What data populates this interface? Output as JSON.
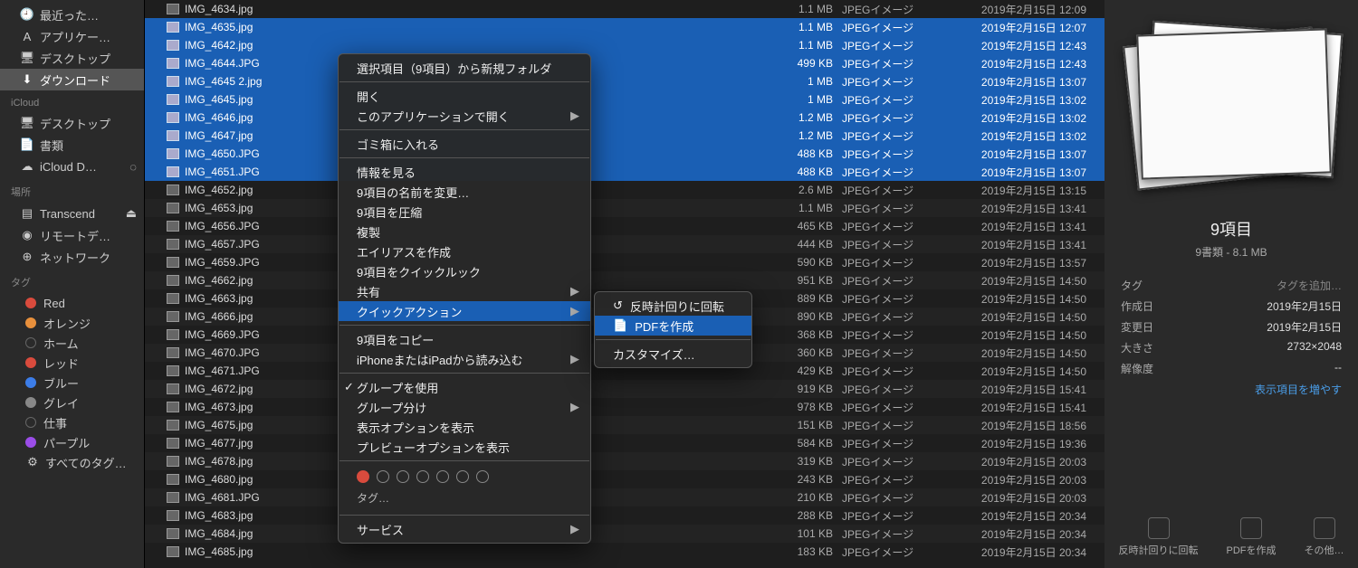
{
  "sidebar": {
    "favorites": [
      {
        "icon": "🕘",
        "label": "最近った…"
      },
      {
        "icon": "A",
        "label": "アプリケー…"
      },
      {
        "icon": "🖥",
        "label": "デスクトップ"
      },
      {
        "icon": "⬇",
        "label": "ダウンロード",
        "active": true
      }
    ],
    "icloud_header": "iCloud",
    "icloud": [
      {
        "icon": "🖥",
        "label": "デスクトップ"
      },
      {
        "icon": "📄",
        "label": "書類"
      },
      {
        "icon": "☁︎",
        "label": "iCloud D…",
        "spinner": true
      }
    ],
    "locations_header": "場所",
    "locations": [
      {
        "icon": "▤",
        "label": "Transcend",
        "eject": true
      },
      {
        "icon": "◉",
        "label": "リモートデ…"
      },
      {
        "icon": "⊕",
        "label": "ネットワーク"
      }
    ],
    "tags_header": "タグ",
    "tags": [
      {
        "color": "#d94b3d",
        "label": "Red"
      },
      {
        "color": "#e8903c",
        "label": "オレンジ"
      },
      {
        "color": "transparent",
        "label": "ホーム"
      },
      {
        "color": "#d94b3d",
        "label": "レッド"
      },
      {
        "color": "#3c7de8",
        "label": "ブルー"
      },
      {
        "color": "#888",
        "label": "グレイ"
      },
      {
        "color": "transparent",
        "label": "仕事"
      },
      {
        "color": "#9b4de8",
        "label": "パープル"
      },
      {
        "color": "gear",
        "label": "すべてのタグ…"
      }
    ]
  },
  "files": [
    {
      "n": "IMG_4634.jpg",
      "s": "1.1 MB",
      "k": "JPEGイメージ",
      "d": "2019年2月15日 12:09",
      "sel": false
    },
    {
      "n": "IMG_4635.jpg",
      "s": "1.1 MB",
      "k": "JPEGイメージ",
      "d": "2019年2月15日 12:07",
      "sel": true
    },
    {
      "n": "IMG_4642.jpg",
      "s": "1.1 MB",
      "k": "JPEGイメージ",
      "d": "2019年2月15日 12:43",
      "sel": true
    },
    {
      "n": "IMG_4644.JPG",
      "s": "499 KB",
      "k": "JPEGイメージ",
      "d": "2019年2月15日 12:43",
      "sel": true
    },
    {
      "n": "IMG_4645 2.jpg",
      "s": "1 MB",
      "k": "JPEGイメージ",
      "d": "2019年2月15日 13:07",
      "sel": true
    },
    {
      "n": "IMG_4645.jpg",
      "s": "1 MB",
      "k": "JPEGイメージ",
      "d": "2019年2月15日 13:02",
      "sel": true
    },
    {
      "n": "IMG_4646.jpg",
      "s": "1.2 MB",
      "k": "JPEGイメージ",
      "d": "2019年2月15日 13:02",
      "sel": true
    },
    {
      "n": "IMG_4647.jpg",
      "s": "1.2 MB",
      "k": "JPEGイメージ",
      "d": "2019年2月15日 13:02",
      "sel": true
    },
    {
      "n": "IMG_4650.JPG",
      "s": "488 KB",
      "k": "JPEGイメージ",
      "d": "2019年2月15日 13:07",
      "sel": true
    },
    {
      "n": "IMG_4651.JPG",
      "s": "488 KB",
      "k": "JPEGイメージ",
      "d": "2019年2月15日 13:07",
      "sel": true
    },
    {
      "n": "IMG_4652.jpg",
      "s": "2.6 MB",
      "k": "JPEGイメージ",
      "d": "2019年2月15日 13:15",
      "sel": false
    },
    {
      "n": "IMG_4653.jpg",
      "s": "1.1 MB",
      "k": "JPEGイメージ",
      "d": "2019年2月15日 13:41",
      "sel": false
    },
    {
      "n": "IMG_4656.JPG",
      "s": "465 KB",
      "k": "JPEGイメージ",
      "d": "2019年2月15日 13:41",
      "sel": false
    },
    {
      "n": "IMG_4657.JPG",
      "s": "444 KB",
      "k": "JPEGイメージ",
      "d": "2019年2月15日 13:41",
      "sel": false
    },
    {
      "n": "IMG_4659.JPG",
      "s": "590 KB",
      "k": "JPEGイメージ",
      "d": "2019年2月15日 13:57",
      "sel": false
    },
    {
      "n": "IMG_4662.jpg",
      "s": "951 KB",
      "k": "JPEGイメージ",
      "d": "2019年2月15日 14:50",
      "sel": false
    },
    {
      "n": "IMG_4663.jpg",
      "s": "889 KB",
      "k": "JPEGイメージ",
      "d": "2019年2月15日 14:50",
      "sel": false
    },
    {
      "n": "IMG_4666.jpg",
      "s": "890 KB",
      "k": "JPEGイメージ",
      "d": "2019年2月15日 14:50",
      "sel": false
    },
    {
      "n": "IMG_4669.JPG",
      "s": "368 KB",
      "k": "JPEGイメージ",
      "d": "2019年2月15日 14:50",
      "sel": false
    },
    {
      "n": "IMG_4670.JPG",
      "s": "360 KB",
      "k": "JPEGイメージ",
      "d": "2019年2月15日 14:50",
      "sel": false
    },
    {
      "n": "IMG_4671.JPG",
      "s": "429 KB",
      "k": "JPEGイメージ",
      "d": "2019年2月15日 14:50",
      "sel": false
    },
    {
      "n": "IMG_4672.jpg",
      "s": "919 KB",
      "k": "JPEGイメージ",
      "d": "2019年2月15日 15:41",
      "sel": false
    },
    {
      "n": "IMG_4673.jpg",
      "s": "978 KB",
      "k": "JPEGイメージ",
      "d": "2019年2月15日 15:41",
      "sel": false
    },
    {
      "n": "IMG_4675.jpg",
      "s": "151 KB",
      "k": "JPEGイメージ",
      "d": "2019年2月15日 18:56",
      "sel": false
    },
    {
      "n": "IMG_4677.jpg",
      "s": "584 KB",
      "k": "JPEGイメージ",
      "d": "2019年2月15日 19:36",
      "sel": false
    },
    {
      "n": "IMG_4678.jpg",
      "s": "319 KB",
      "k": "JPEGイメージ",
      "d": "2019年2月15日 20:03",
      "sel": false
    },
    {
      "n": "IMG_4680.jpg",
      "s": "243 KB",
      "k": "JPEGイメージ",
      "d": "2019年2月15日 20:03",
      "sel": false
    },
    {
      "n": "IMG_4681.JPG",
      "s": "210 KB",
      "k": "JPEGイメージ",
      "d": "2019年2月15日 20:03",
      "sel": false
    },
    {
      "n": "IMG_4683.jpg",
      "s": "288 KB",
      "k": "JPEGイメージ",
      "d": "2019年2月15日 20:34",
      "sel": false
    },
    {
      "n": "IMG_4684.jpg",
      "s": "101 KB",
      "k": "JPEGイメージ",
      "d": "2019年2月15日 20:34",
      "sel": false
    },
    {
      "n": "IMG_4685.jpg",
      "s": "183 KB",
      "k": "JPEGイメージ",
      "d": "2019年2月15日 20:34",
      "sel": false
    }
  ],
  "context_menu": {
    "items": [
      {
        "label": "選択項目（9項目）から新規フォルダ"
      },
      {
        "sep": true
      },
      {
        "label": "開く"
      },
      {
        "label": "このアプリケーションで開く",
        "sub": true
      },
      {
        "sep": true
      },
      {
        "label": "ゴミ箱に入れる"
      },
      {
        "sep": true
      },
      {
        "label": "情報を見る"
      },
      {
        "label": "9項目の名前を変更…"
      },
      {
        "label": "9項目を圧縮"
      },
      {
        "label": "複製"
      },
      {
        "label": "エイリアスを作成"
      },
      {
        "label": "9項目をクイックルック"
      },
      {
        "label": "共有",
        "sub": true
      },
      {
        "label": "クイックアクション",
        "sub": true,
        "hi": true
      },
      {
        "sep": true
      },
      {
        "label": "9項目をコピー"
      },
      {
        "label": "iPhoneまたはiPadから読み込む",
        "sub": true
      },
      {
        "sep": true
      },
      {
        "label": "グループを使用",
        "check": true
      },
      {
        "label": "グループ分け",
        "sub": true
      },
      {
        "label": "表示オプションを表示"
      },
      {
        "label": "プレビューオプションを表示"
      },
      {
        "sep": true
      },
      {
        "taglabel": "タグ…"
      },
      {
        "sep": true
      },
      {
        "label": "サービス",
        "sub": true
      }
    ]
  },
  "submenu": {
    "items": [
      {
        "label": "反時計回りに回転",
        "icon": "↺"
      },
      {
        "label": "PDFを作成",
        "icon": "📄",
        "hi": true
      },
      {
        "sep": true
      },
      {
        "label": "カスタマイズ…"
      }
    ]
  },
  "preview": {
    "title": "9項目",
    "subtitle": "9書類 - 8.1 MB",
    "meta": [
      {
        "label": "タグ",
        "value": "タグを追加…",
        "link": true
      },
      {
        "label": "作成日",
        "value": "2019年2月15日"
      },
      {
        "label": "変更日",
        "value": "2019年2月15日"
      },
      {
        "label": "大きさ",
        "value": "2732×2048"
      },
      {
        "label": "解像度",
        "value": "--"
      }
    ],
    "more": "表示項目を増やす",
    "actions": [
      {
        "label": "反時計回りに回転"
      },
      {
        "label": "PDFを作成"
      },
      {
        "label": "その他…"
      }
    ]
  }
}
